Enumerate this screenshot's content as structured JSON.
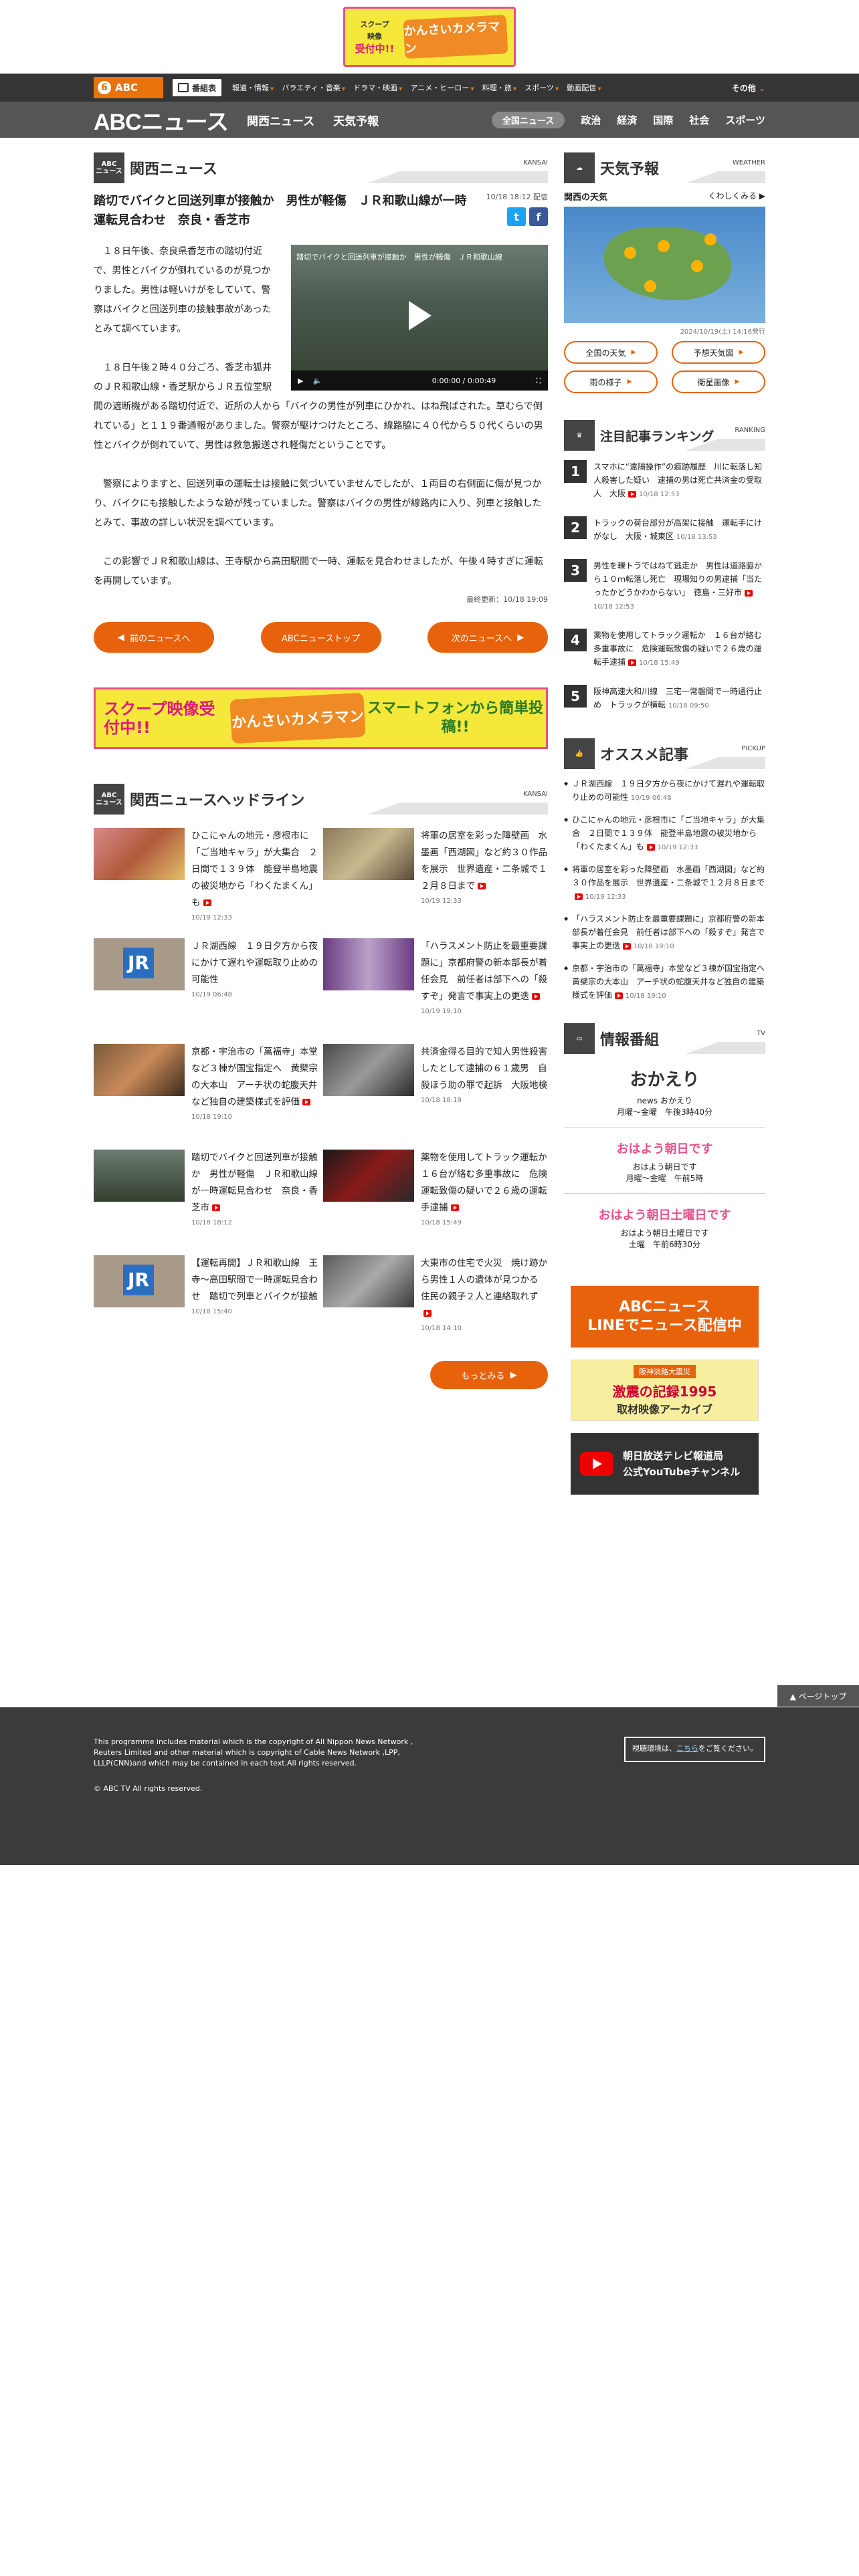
{
  "top_banner": {
    "left_line1": "スクープ",
    "left_line2": "映像",
    "left_line3": "受付中!!",
    "right": "かんさいカメラマン"
  },
  "nav1": {
    "logo": "ABC",
    "logo_num": "6",
    "program_btn": "番組表",
    "links": [
      "報道・情報",
      "バラエティ・音楽",
      "ドラマ・映画",
      "アニメ・ヒーロー",
      "料理・旅",
      "スポーツ",
      "動画配信"
    ],
    "other": "その他"
  },
  "nav2": {
    "logo": "ABCニュース",
    "main_links": [
      "関西ニュース",
      "天気予報"
    ],
    "cats": [
      "全国ニュース",
      "政治",
      "経済",
      "国際",
      "社会",
      "スポーツ"
    ]
  },
  "section": {
    "badge1": "ABC",
    "badge2": "ニュース",
    "title": "関西ニュース",
    "en": "KANSAI"
  },
  "article": {
    "title": "踏切でバイクと回送列車が接触か　男性が軽傷　ＪＲ和歌山線が一時運転見合わせ　奈良・香芝市",
    "date": "10/18 18:12 配信",
    "video_caption": "踏切でバイクと回送列車が接触か　男性が軽傷　ＪＲ和歌山線",
    "video_time": "0:00:00 / 0:00:49",
    "paragraphs": [
      "１８日午後、奈良県香芝市の踏切付近で、男性とバイクが倒れているのが見つかりました。男性は軽いけがをしていて、警察はバイクと回送列車の接触事故があったとみて調べています。",
      "１８日午後２時４０分ごろ、香芝市狐井のＪＲ和歌山線・香芝駅からＪＲ五位堂駅間の遮断機がある踏切付近で、近所の人から「バイクの男性が列車にひかれ、はね飛ばされた。草むらで倒れている」と１１９番通報がありました。警察が駆けつけたところ、線路脇に４０代から５０代くらいの男性とバイクが倒れていて、男性は救急搬送され軽傷だということです。",
      "警察によりますと、回送列車の運転士は接触に気づいていませんでしたが、１両目の右側面に傷が見つかり、バイクにも接触したような跡が残っていました。警察はバイクの男性が線路内に入り、列車と接触したとみて、事故の詳しい状況を調べています。",
      "この影響でＪＲ和歌山線は、王寺駅から高田駅間で一時、運転を見合わせましたが、午後４時すぎに運転を再開しています。"
    ],
    "updated": "最終更新：10/18 19:09"
  },
  "pager": {
    "prev": "前のニュースへ",
    "top": "ABCニューストップ",
    "next": "次のニュースへ"
  },
  "wide_banner": {
    "a": "スクープ映像受付中!!",
    "b": "かんさいカメラマン",
    "c": "スマートフォンから簡単投稿!!"
  },
  "headlines_section": {
    "title": "関西ニュースヘッドライン",
    "en": "KANSAI"
  },
  "headlines": [
    {
      "text": "ひこにゃんの地元・彦根市に「ご当地キャラ」が大集合　２日間で１３９体　能登半島地震の被災地から「わくたまくん」も",
      "date": "10/19 12:33"
    },
    {
      "text": "将軍の居室を彩った障壁画　水墨画「西湖図」など約３０作品を展示　世界遺産・二条城で１２月８日まで",
      "date": "10/19 12:33"
    },
    {
      "text": "ＪＲ湖西線　１９日夕方から夜にかけて遅れや運転取り止めの可能性",
      "date": "10/19 06:48"
    },
    {
      "text": "「ハラスメント防止を最重要課題に」京都府警の新本部長が着任会見　前任者は部下への「殺すぞ」発言で事実上の更迭",
      "date": "10/19 19:10"
    },
    {
      "text": "京都・宇治市の「萬福寺」本堂など３棟が国宝指定へ　黄檗宗の大本山　アーチ状の蛇腹天井など独自の建築様式を評価",
      "date": "10/18 19:10"
    },
    {
      "text": "共済金得る目的で知人男性殺害したとして逮捕の６１歳男　自殺ほう助の罪で起訴　大阪地検",
      "date": "10/18 18:19"
    },
    {
      "text": "踏切でバイクと回送列車が接触か　男性が軽傷　ＪＲ和歌山線が一時運転見合わせ　奈良・香芝市",
      "date": "10/18 18:12"
    },
    {
      "text": "薬物を使用してトラック運転か　１６台が絡む多重事故に　危険運転致傷の疑いで２６歳の運転手逮捕",
      "date": "10/18 15:49"
    },
    {
      "text": "【運転再開】ＪＲ和歌山線　王寺～高田駅間で一時運転見合わせ　踏切で列車とバイクが接触",
      "date": "10/18 15:40"
    },
    {
      "text": "大東市の住宅で火災　焼け跡から男性１人の遺体が見つかる　住民の親子２人と連絡取れず",
      "date": "10/18 14:10"
    }
  ],
  "more": "もっとみる",
  "weather": {
    "title": "天気予報",
    "en": "WEATHER",
    "region": "関西の天気",
    "detail": "くわしくみる",
    "date": "2024/10/19(土) 14:16発行",
    "btns": [
      "全国の天気",
      "予想天気図",
      "雨の様子",
      "衛星画像"
    ]
  },
  "ranking": {
    "title": "注目記事ランキング",
    "en": "RANKING",
    "items": [
      {
        "num": "1",
        "text": "スマホに“遠隔操作”の痕跡履歴　川に転落し知人殺害した疑い　逮捕の男は死亡共済金の受取人　大阪",
        "date": "10/18 12:53"
      },
      {
        "num": "2",
        "text": "トラックの荷台部分が高架に接触　運転手にけがなし　大阪・城東区",
        "date": "10/18 13:53"
      },
      {
        "num": "3",
        "text": "男性を轢トラではねて逃走か　男性は道路脇から１０ｍ転落し死亡　現場知りの男逮捕「当たったかどうかわからない」　徳島・三好市",
        "date": "10/18 12:53"
      },
      {
        "num": "4",
        "text": "薬物を使用してトラック運転か　１６台が絡む多重事故に　危険運転致傷の疑いで２６歳の運転手逮捕",
        "date": "10/18 15:49"
      },
      {
        "num": "5",
        "text": "阪神高速大和川線　三宅一常磐間で一時通行止め　トラックが横転",
        "date": "10/18 09:50"
      }
    ]
  },
  "pickup": {
    "title": "オススメ記事",
    "en": "PICKUP",
    "items": [
      {
        "text": "ＪＲ湖西線　１９日夕方から夜にかけて遅れや運転取り止めの可能性",
        "date": "10/19 06:48"
      },
      {
        "text": "ひこにゃんの地元・彦根市に「ご当地キャラ」が大集合　２日間で１３９体　能登半島地震の被災地から「わくたまくん」も",
        "date": "10/19 12:33"
      },
      {
        "text": "将軍の居室を彩った障壁画　水墨画「西湖図」など約３０作品を展示　世界遺産・二条城で１２月８日まで",
        "date": "10/19 12:33"
      },
      {
        "text": "「ハラスメント防止を最重要課題に」京都府警の新本部長が着任会見　前任者は部下への「殺すぞ」発言で事実上の更迭",
        "date": "10/18 19:10"
      },
      {
        "text": "京都・宇治市の「萬福寺」本堂など３棟が国宝指定へ　黄檗宗の大本山　アーチ状の蛇腹天井など独自の建築様式を評価",
        "date": "10/18 19:10"
      }
    ]
  },
  "programs": {
    "title": "情報番組",
    "en": "TV",
    "items": [
      {
        "logo": "おかえり",
        "name": "news おかえり",
        "time": "月曜〜金曜　午後3時40分"
      },
      {
        "logo": "おはよう朝日です",
        "name": "おはよう朝日です",
        "time": "月曜〜金曜　午前5時"
      },
      {
        "logo": "おはよう朝日土曜日です",
        "name": "おはよう朝日土曜日です",
        "time": "土曜　午前6時30分"
      }
    ]
  },
  "side_banners": {
    "line1": "ABCニュース",
    "line2": "LINEでニュース配信中",
    "quake_a": "阪神淡路大震災",
    "quake_b": "激震の記録1995",
    "quake_c": "取材映像アーカイブ",
    "yt1": "朝日放送テレビ報道局",
    "yt2": "公式YouTubeチャンネル"
  },
  "pagetop": "▲ ページトップ",
  "footer": {
    "copy1": "This programme includes material which is the copyright of All Nippon News Network ,",
    "copy2": "Reuters Limited and other material which is copyright of Cable News Network ,LPP,",
    "copy3": "LLLP(CNN)and which may be contained in each text.All rights reserved.",
    "copyright": "© ABC TV All rights reserved.",
    "box_pre": "視聴環境は、",
    "box_link": "こちら",
    "box_post": "をご覧ください。"
  }
}
